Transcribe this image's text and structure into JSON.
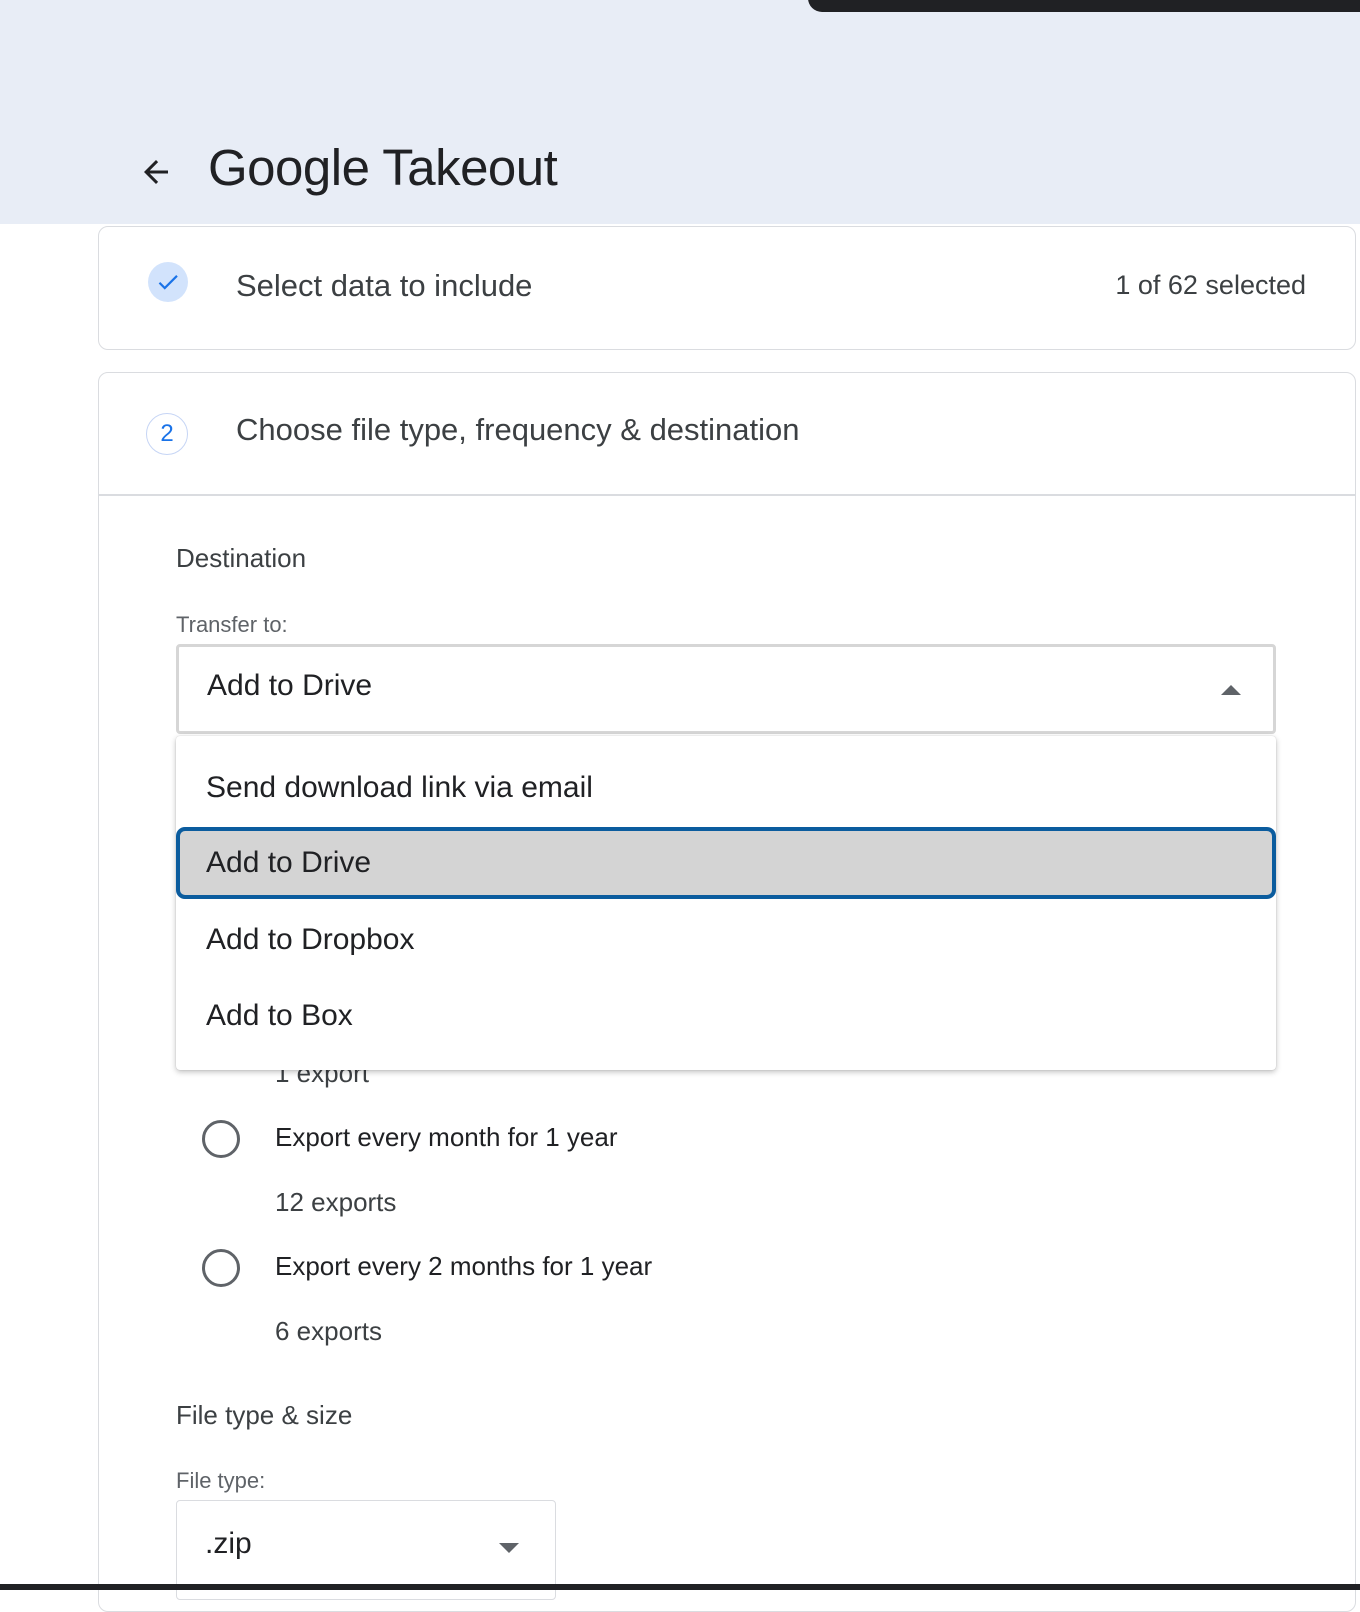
{
  "header": {
    "title": "Google Takeout",
    "back_icon": "arrow-left-icon"
  },
  "steps": [
    {
      "number": "",
      "title": "Select data to include",
      "count": "1 of 62 selected",
      "status_icon": "checkmark-icon"
    },
    {
      "number": "2",
      "title": "Choose file type, frequency & destination"
    }
  ],
  "destination": {
    "heading": "Destination",
    "transfer_label": "Transfer to:",
    "selected_value": "Add to Drive",
    "options": [
      "Send download link via email",
      "Add to Drive",
      "Add to Dropbox",
      "Add to Box"
    ],
    "highlighted_option": "Add to Drive"
  },
  "frequency": {
    "partial_text": "1 export",
    "options": [
      {
        "label": "Export every month for 1 year",
        "sub": "12 exports",
        "selected": false
      },
      {
        "label": "Export every 2 months for 1 year",
        "sub": "6 exports",
        "selected": false
      }
    ]
  },
  "file_type": {
    "heading": "File type & size",
    "label": "File type:",
    "value": ".zip"
  },
  "colors": {
    "header_bg": "#e8edf6",
    "accent_blue": "#1a73e8",
    "focus_border": "#0b5c9e",
    "highlight_bg": "#d4d4d4"
  }
}
